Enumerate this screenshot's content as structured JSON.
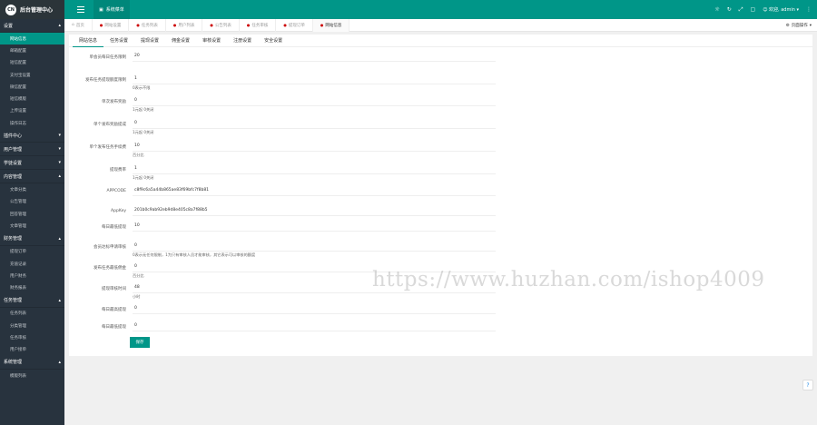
{
  "header": {
    "logo_text": "CN",
    "title": "后台管理中心",
    "home_label": "系统菜单",
    "right": {
      "user_label": "欢迎, admin",
      "icons": [
        "sun-icon",
        "refresh-icon",
        "fullscreen-icon",
        "lock-icon"
      ]
    }
  },
  "tabs": [
    {
      "label": "首页",
      "closable": false
    },
    {
      "label": "网站设置",
      "closable": true
    },
    {
      "label": "任务列表",
      "closable": true
    },
    {
      "label": "用户列表",
      "closable": true
    },
    {
      "label": "公告列表",
      "closable": true
    },
    {
      "label": "任务审核",
      "closable": true
    },
    {
      "label": "提现订单",
      "closable": true
    },
    {
      "label": "网站信息",
      "closable": true
    }
  ],
  "tab_ops_label": "页面操作",
  "sidebar": {
    "groups": [
      {
        "label": "设置",
        "items": [
          "网站信息",
          "邮箱配置",
          "短信配置",
          "支付宝设置",
          "微信配置",
          "短信模版",
          "上传设置",
          "操作日志"
        ]
      },
      {
        "label": "插件中心",
        "items": []
      },
      {
        "label": "用户管理",
        "items": []
      },
      {
        "label": "学徒设置",
        "items": []
      },
      {
        "label": "内容管理",
        "items": [
          "文章分类",
          "公告管理",
          "回答管理",
          "文章管理"
        ]
      },
      {
        "label": "财务管理",
        "items": [
          "提现订单",
          "充值记录",
          "用户财务",
          "财务报表"
        ]
      },
      {
        "label": "任务管理",
        "items": [
          "任务列表",
          "分类管理",
          "任务审核",
          "用户接单"
        ]
      },
      {
        "label": "系统管理",
        "items": [
          "模版列表"
        ]
      }
    ]
  },
  "subtabs": [
    "网站信息",
    "任务设置",
    "提现设置",
    "佣金设置",
    "审核设置",
    "注册设置",
    "安全设置"
  ],
  "form": [
    {
      "label": "单会员每日任务限制",
      "value": "20",
      "hint": ""
    },
    {
      "label": "发布任务提现额度限制",
      "value": "1",
      "hint": "0表示不限"
    },
    {
      "label": "单次发布奖励",
      "value": "0",
      "hint": "1元起 0关闭"
    },
    {
      "label": "单个发布奖励提成",
      "value": "0",
      "hint": "1元起 0关闭"
    },
    {
      "label": "单个发布任务手续费",
      "value": "10",
      "hint": "百分比"
    },
    {
      "label": "提现费率",
      "value": "1",
      "hint": "1元起 0关闭"
    },
    {
      "label": "APPCODE",
      "value": "c8f9c6a5a44b865ae83f69bfc7f8b81",
      "hint": ""
    },
    {
      "label": "AppKey",
      "value": "201b0c9ab92eb9d8e405c8a7f88b5",
      "hint": ""
    },
    {
      "label": "每日最低提现",
      "value": "10",
      "hint": ""
    },
    {
      "label": "会员达标申请审核",
      "value": "0",
      "hint": "0表示无任何限制，1为只有审核人员才能审核，其它表示可以审核的额度"
    },
    {
      "label": "发布任务最低佣金",
      "value": "0",
      "hint": "百分比"
    },
    {
      "label": "提现审核时间",
      "value": "48",
      "hint": "小时"
    },
    {
      "label": "每日最高提现",
      "value": "0",
      "hint": ""
    },
    {
      "label": "每日最低提现",
      "value": "0",
      "hint": ""
    }
  ],
  "save_label": "保存",
  "watermark": "https://www.huzhan.com/ishop4009",
  "colors": {
    "accent": "#009688",
    "sidebar_bg": "#28333e",
    "logo_bg": "#2b3439"
  }
}
